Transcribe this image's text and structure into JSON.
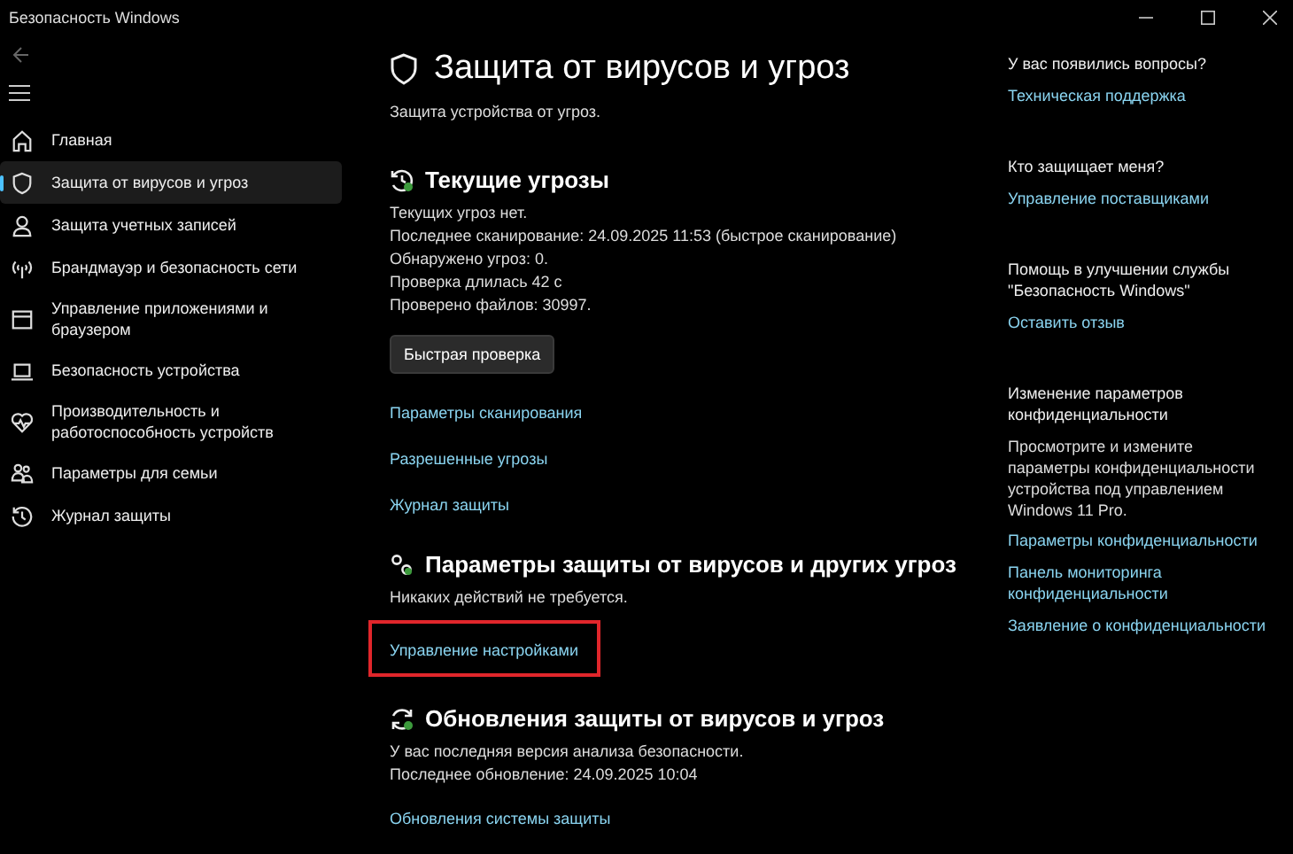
{
  "window": {
    "title": "Безопасность Windows"
  },
  "sidebar": {
    "items": [
      {
        "label": "Главная",
        "selected": false
      },
      {
        "label": "Защита от вирусов и угроз",
        "selected": true
      },
      {
        "label": "Защита учетных записей",
        "selected": false
      },
      {
        "label": "Брандмауэр и безопасность сети",
        "selected": false
      },
      {
        "label": "Управление приложениями и браузером",
        "selected": false
      },
      {
        "label": "Безопасность устройства",
        "selected": false
      },
      {
        "label": "Производительность и работоспособность устройств",
        "selected": false
      },
      {
        "label": "Параметры для семьи",
        "selected": false
      },
      {
        "label": "Журнал защиты",
        "selected": false
      }
    ]
  },
  "page": {
    "title": "Защита от вирусов и угроз",
    "subtitle": "Защита устройства от угроз."
  },
  "sections": [
    {
      "title": "Текущие угрозы",
      "lines": [
        "Текущих угроз нет.",
        "Последнее сканирование: 24.09.2025 11:53 (быстрое сканирование)",
        "Обнаружено угроз: 0.",
        "Проверка длилась 42 с",
        "Проверено файлов: 30997."
      ],
      "button": "Быстрая проверка",
      "links": [
        {
          "label": "Параметры сканирования",
          "highlighted": false
        },
        {
          "label": "Разрешенные угрозы",
          "highlighted": false
        },
        {
          "label": "Журнал защиты",
          "highlighted": false
        }
      ]
    },
    {
      "title": "Параметры защиты от вирусов и других угроз",
      "lines": [
        "Никаких действий не требуется."
      ],
      "links": [
        {
          "label": "Управление настройками",
          "highlighted": true
        }
      ]
    },
    {
      "title": "Обновления защиты от вирусов и угроз",
      "lines": [
        "У вас последняя версия анализа безопасности.",
        "Последнее обновление: 24.09.2025 10:04"
      ],
      "links": [
        {
          "label": "Обновления системы защиты",
          "highlighted": false
        }
      ]
    }
  ],
  "aside": [
    {
      "heading": "У вас появились вопросы?",
      "links": [
        "Техническая поддержка"
      ]
    },
    {
      "heading": "Кто защищает меня?",
      "links": [
        "Управление поставщиками"
      ]
    },
    {
      "heading": "Помощь в улучшении службы \"Безопасность Windows\"",
      "links": [
        "Оставить отзыв"
      ]
    },
    {
      "heading": "Изменение параметров конфиденциальности",
      "text": "Просмотрите и измените параметры конфиденциальности устройства под управлением Windows 11 Pro.",
      "links": [
        "Параметры конфиденциальности",
        "Панель мониторинга конфиденциальности",
        "Заявление о конфиденциальности"
      ]
    }
  ]
}
